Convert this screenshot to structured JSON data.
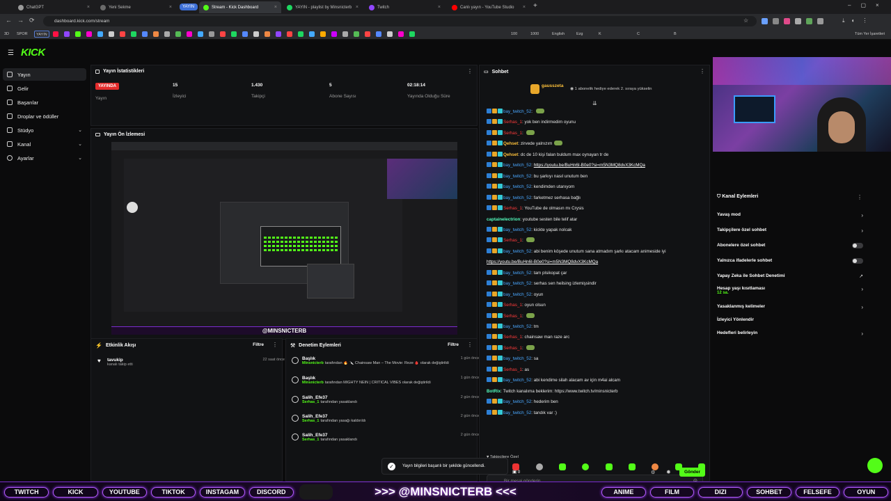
{
  "browser": {
    "tabs": [
      {
        "title": "ChatGPT",
        "active": false
      },
      {
        "title": "Yeni Sekme",
        "active": false
      },
      {
        "title": "Stream - Kick Dashboard",
        "active": true
      },
      {
        "title": "YAYIN - playlist by Minsnicterb",
        "active": false
      },
      {
        "title": "Twitch",
        "active": false
      },
      {
        "title": "Canlı yayın - YouTube Studio",
        "active": false
      }
    ],
    "tab_group_label": "YAYIN",
    "url": "dashboard.kick.com/stream",
    "bookmarks": [
      "3D",
      "SPOR",
      "YAYIN",
      "English",
      "Ezg",
      "K",
      "C",
      "B",
      "1000",
      "100",
      "Tüm Yer İşaretleri"
    ]
  },
  "sidebar": {
    "logo": "KICK",
    "items": [
      {
        "label": "Yayın",
        "expand": ""
      },
      {
        "label": "Gelir",
        "expand": ""
      },
      {
        "label": "Başarılar",
        "expand": ""
      },
      {
        "label": "Droplar ve ödüller",
        "expand": ""
      },
      {
        "label": "Stüdyo",
        "expand": "⌄"
      },
      {
        "label": "Kanal",
        "expand": "⌄"
      },
      {
        "label": "Ayarlar",
        "expand": "⌄"
      }
    ]
  },
  "stats": {
    "title": "Yayın İstatistikleri",
    "live_badge": "YAYINDA",
    "items": [
      {
        "value": "",
        "label": "Yayın"
      },
      {
        "value": "15",
        "label": "İzleyici"
      },
      {
        "value": "1.430",
        "label": "Takipçi"
      },
      {
        "value": "5",
        "label": "Abone Sayısı"
      },
      {
        "value": "02:18:14",
        "label": "Yayında Olduğu Süre"
      }
    ]
  },
  "preview": {
    "title": "Yayın Ön İzlemesi",
    "handle": "@MINSNICTERB"
  },
  "activity": {
    "title": "Etkinlik Akışı",
    "filter": "Filtre",
    "items": [
      {
        "user": "tavukip",
        "text": "kanalı takip etti",
        "time": "22 saat önce"
      }
    ]
  },
  "moderation": {
    "title": "Denetim Eylemleri",
    "filter": "Filtre",
    "items": [
      {
        "title": "Başlık",
        "actor": "Minsnicterb",
        "text": "tarafından 🔥 🔪 Chainsaw Man – The Movie: Reze 🩸 olarak değiştirildi",
        "time": "1 gün önce"
      },
      {
        "title": "Başlık",
        "actor": "Minsnicterb",
        "text": "tarafından MIGHTY NEIN | CRITICAL VIBES olarak değiştirildi",
        "time": "1 gün önce"
      },
      {
        "title": "Salih_Efe37",
        "actor": "Serhas_1",
        "text": "tarafından yasaklandı",
        "time": "2 gün önce"
      },
      {
        "title": "Salih_Efe37",
        "actor": "Serhas_1",
        "text": "tarafından yasağı kaldırıldı",
        "time": "2 gün önce"
      },
      {
        "title": "Salih_Efe37",
        "actor": "Serhas_1",
        "text": "tarafından yasaklandı",
        "time": "2 gün önce"
      }
    ]
  },
  "chat": {
    "title": "Sohbet",
    "pinned_user": "gausszeta",
    "pinned_text": "1 abonelik hediye ederek 2. sıraya yükselin",
    "messages": [
      {
        "user": "bay_twitch_52",
        "color": "blue",
        "text": "",
        "emote": true
      },
      {
        "user": "Serhas_1",
        "color": "red",
        "text": "yok ben indirmedim oyunu",
        "emote": false
      },
      {
        "user": "Serhas_1",
        "color": "red",
        "text": "",
        "emote": true
      },
      {
        "user": "Qehset",
        "color": "gold",
        "text": "zirvede yalnızım",
        "emote": true
      },
      {
        "user": "Qehset",
        "color": "gold",
        "text": "dc de 10 kişi falan buldum max oynayan tr de",
        "emote": false
      },
      {
        "user": "bay_twitch_52",
        "color": "blue",
        "text": "https://youtu.be/BuHn6I-B0e0?si=m5N3MQ8dvX3KcMQa",
        "emote": false,
        "link": true
      },
      {
        "user": "bay_twitch_52",
        "color": "blue",
        "text": "bu şarkıyı nasıl unutum ben",
        "emote": false
      },
      {
        "user": "bay_twitch_52",
        "color": "blue",
        "text": "kendimden utanıyom",
        "emote": false
      },
      {
        "user": "bay_twitch_52",
        "color": "blue",
        "text": "farketmez serhasa bağlı",
        "emote": false
      },
      {
        "user": "Serhas_1",
        "color": "red",
        "text": "YouTube de olmasın mı Crysis",
        "emote": false
      },
      {
        "user": "captainelectrion",
        "color": "teal",
        "text": "youtube sesten bile telif atar",
        "emote": false
      },
      {
        "user": "bay_twitch_52",
        "color": "blue",
        "text": "kickte yapak nolcak",
        "emote": false
      },
      {
        "user": "Serhas_1",
        "color": "red",
        "text": "",
        "emote": true
      },
      {
        "user": "bay_twitch_52",
        "color": "blue",
        "text": "abi benim köşede unutum sana atmadım şarkı atacam animeside iyi",
        "emote": false
      },
      {
        "user": "",
        "color": "blue",
        "text": "https://youtu.be/BuHn6I-B0e0?si=m5N3MQ8dvX3KcMQa",
        "emote": false,
        "link": true
      },
      {
        "user": "bay_twitch_52",
        "color": "blue",
        "text": "tam plsikopat çar",
        "emote": false
      },
      {
        "user": "bay_twitch_52",
        "color": "blue",
        "text": "serhas sen heilsing izlemişsindir",
        "emote": false
      },
      {
        "user": "bay_twitch_52",
        "color": "blue",
        "text": "oyun",
        "emote": false
      },
      {
        "user": "Serhas_1",
        "color": "red",
        "text": "oyun olsun",
        "emote": false
      },
      {
        "user": "Serhas_1",
        "color": "red",
        "text": "",
        "emote": true
      },
      {
        "user": "bay_twitch_52",
        "color": "blue",
        "text": "tm",
        "emote": false
      },
      {
        "user": "Serhas_1",
        "color": "red",
        "text": "chainsaw man raze arc",
        "emote": false
      },
      {
        "user": "Serhas_1",
        "color": "red",
        "text": "",
        "emote": true
      },
      {
        "user": "bay_twitch_52",
        "color": "blue",
        "text": "sa",
        "emote": false
      },
      {
        "user": "Serhas_1",
        "color": "red",
        "text": "as",
        "emote": false
      },
      {
        "user": "bay_twitch_52",
        "color": "blue",
        "text": "abi kendime silah alacam av için m4ai alcam",
        "emote": false
      },
      {
        "user": "BotRix",
        "color": "teal",
        "text": "Twitch kanalıma beklerim: https://www.twitch.tv/minsnicterb",
        "emote": false
      },
      {
        "user": "bay_twitch_52",
        "color": "blue",
        "text": "hederim ben",
        "emote": false
      },
      {
        "user": "bay_twitch_52",
        "color": "blue",
        "text": "tandık var :)",
        "emote": false
      }
    ],
    "followers_only": "Takipçilere Özel",
    "input_placeholder": "Bir mesaj gönderin",
    "counter": "0",
    "send": "Gönder"
  },
  "channel_actions": {
    "title": "Kanal Eylemleri",
    "items": [
      {
        "label": "Yavaş mod",
        "kind": "chevron",
        "sub": ""
      },
      {
        "label": "Takipçilere özel sohbet",
        "kind": "chevron",
        "sub": ""
      },
      {
        "label": "Abonelere özel sohbet",
        "kind": "toggle",
        "sub": ""
      },
      {
        "label": "Yalnızca ifadelerle sohbet",
        "kind": "toggle",
        "sub": ""
      },
      {
        "label": "Yapay Zeka ile Sohbet Denetimi",
        "kind": "ext",
        "sub": ""
      },
      {
        "label": "Hesap yaşı kısıtlaması",
        "kind": "chevron",
        "sub": "12 sa."
      },
      {
        "label": "Yasaklanmış kelimeler",
        "kind": "chevron",
        "sub": ""
      },
      {
        "label": "İzleyici Yönlendir",
        "kind": "none",
        "sub": ""
      },
      {
        "label": "Hedefleri belirleyin",
        "kind": "chevron",
        "sub": ""
      }
    ]
  },
  "toast": "Yayın bilgileri başarılı bir şekilde güncellendi.",
  "overlay": {
    "left_buttons": [
      "TWITCH",
      "KICK",
      "YOUTUBE",
      "TIKTOK",
      "INSTAGAM",
      "DISCORD"
    ],
    "handle": ">>> @MINSNICTERB <<<",
    "right_buttons": [
      "ANIME",
      "FILM",
      "DIZI",
      "SOHBET",
      "FELSEFE",
      "OYUN"
    ]
  },
  "colors": {
    "kick_green": "#53fc18",
    "live_red": "#e42c2c",
    "overlay_purple": "#b65cff"
  }
}
